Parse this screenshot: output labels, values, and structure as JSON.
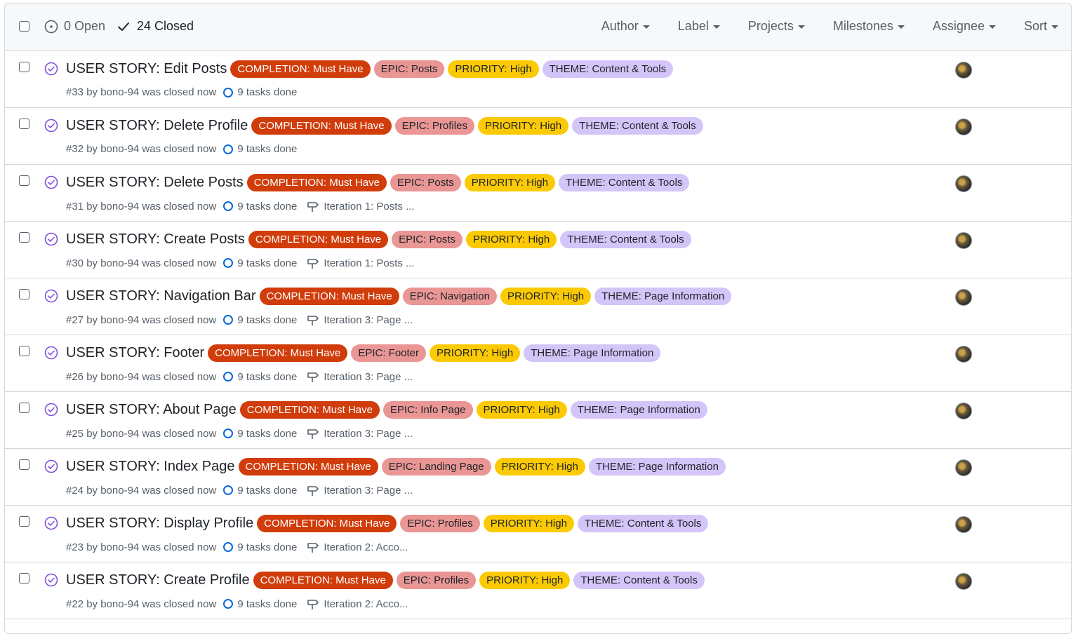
{
  "header": {
    "open_label": "0 Open",
    "closed_label": "24 Closed",
    "filters": [
      {
        "label": "Author"
      },
      {
        "label": "Label"
      },
      {
        "label": "Projects"
      },
      {
        "label": "Milestones"
      },
      {
        "label": "Assignee"
      },
      {
        "label": "Sort"
      }
    ]
  },
  "colors": {
    "completion_bg": "#d13c0b",
    "completion_fg": "#ffffff",
    "epic_bg": "#e99695",
    "epic_fg": "#1f2328",
    "priority_bg": "#fbca04",
    "priority_fg": "#1f2328",
    "theme_bg": "#d4c5f9",
    "theme_fg": "#1f2328",
    "closed_icon": "#8250df",
    "tasks_icon": "#0969da"
  },
  "issues": [
    {
      "title": "USER STORY: Edit Posts",
      "labels": [
        "COMPLETION: Must Have",
        "EPIC: Posts",
        "PRIORITY: High",
        "THEME: Content & Tools"
      ],
      "meta": "#33 by bono-94 was closed now",
      "tasks": "9 tasks done",
      "milestone": ""
    },
    {
      "title": "USER STORY: Delete Profile",
      "labels": [
        "COMPLETION: Must Have",
        "EPIC: Profiles",
        "PRIORITY: High",
        "THEME: Content & Tools"
      ],
      "meta": "#32 by bono-94 was closed now",
      "tasks": "9 tasks done",
      "milestone": ""
    },
    {
      "title": "USER STORY: Delete Posts",
      "labels": [
        "COMPLETION: Must Have",
        "EPIC: Posts",
        "PRIORITY: High",
        "THEME: Content & Tools"
      ],
      "meta": "#31 by bono-94 was closed now",
      "tasks": "9 tasks done",
      "milestone": "Iteration 1: Posts ..."
    },
    {
      "title": "USER STORY: Create Posts",
      "labels": [
        "COMPLETION: Must Have",
        "EPIC: Posts",
        "PRIORITY: High",
        "THEME: Content & Tools"
      ],
      "meta": "#30 by bono-94 was closed now",
      "tasks": "9 tasks done",
      "milestone": "Iteration 1: Posts ..."
    },
    {
      "title": "USER STORY: Navigation Bar",
      "labels": [
        "COMPLETION: Must Have",
        "EPIC: Navigation",
        "PRIORITY: High",
        "THEME: Page Information"
      ],
      "meta": "#27 by bono-94 was closed now",
      "tasks": "9 tasks done",
      "milestone": "Iteration 3: Page ..."
    },
    {
      "title": "USER STORY: Footer",
      "labels": [
        "COMPLETION: Must Have",
        "EPIC: Footer",
        "PRIORITY: High",
        "THEME: Page Information"
      ],
      "meta": "#26 by bono-94 was closed now",
      "tasks": "9 tasks done",
      "milestone": "Iteration 3: Page ..."
    },
    {
      "title": "USER STORY: About Page",
      "labels": [
        "COMPLETION: Must Have",
        "EPIC: Info Page",
        "PRIORITY: High",
        "THEME: Page Information"
      ],
      "meta": "#25 by bono-94 was closed now",
      "tasks": "9 tasks done",
      "milestone": "Iteration 3: Page ..."
    },
    {
      "title": "USER STORY: Index Page",
      "labels": [
        "COMPLETION: Must Have",
        "EPIC: Landing Page",
        "PRIORITY: High",
        "THEME: Page Information"
      ],
      "meta": "#24 by bono-94 was closed now",
      "tasks": "9 tasks done",
      "milestone": "Iteration 3: Page ..."
    },
    {
      "title": "USER STORY: Display Profile",
      "labels": [
        "COMPLETION: Must Have",
        "EPIC: Profiles",
        "PRIORITY: High",
        "THEME: Content & Tools"
      ],
      "meta": "#23 by bono-94 was closed now",
      "tasks": "9 tasks done",
      "milestone": "Iteration 2: Acco..."
    },
    {
      "title": "USER STORY: Create Profile",
      "labels": [
        "COMPLETION: Must Have",
        "EPIC: Profiles",
        "PRIORITY: High",
        "THEME: Content & Tools"
      ],
      "meta": "#22 by bono-94 was closed now",
      "tasks": "9 tasks done",
      "milestone": "Iteration 2: Acco..."
    }
  ]
}
